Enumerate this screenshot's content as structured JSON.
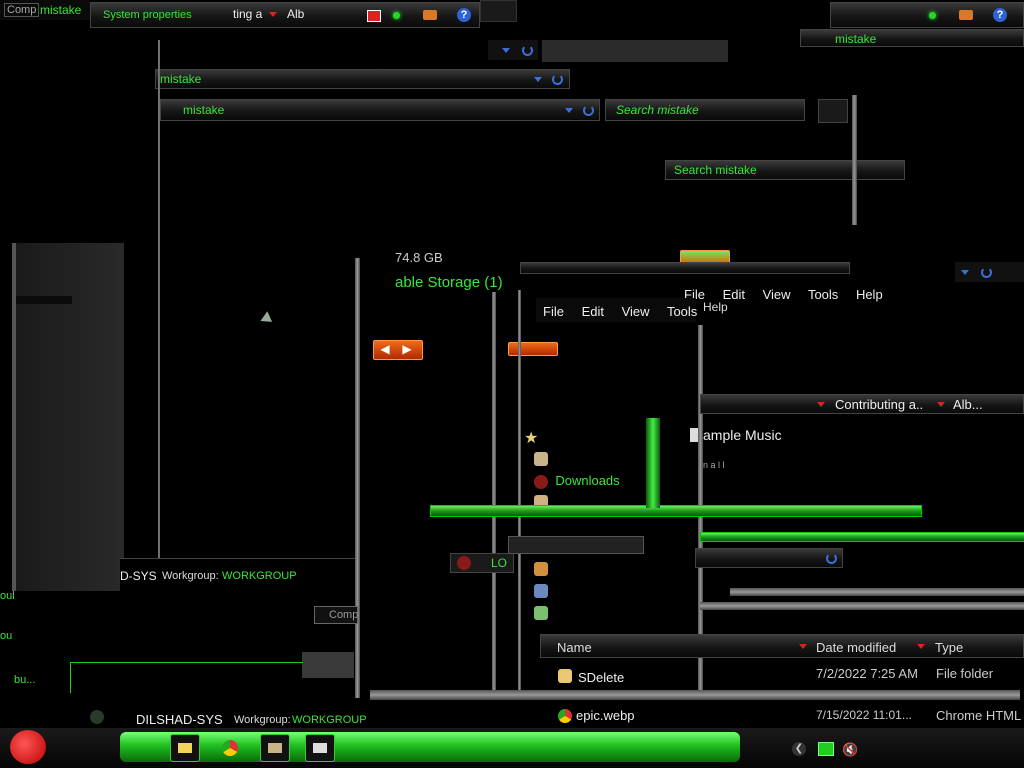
{
  "top_left": {
    "comp_label": "Comp",
    "mistake": "mistake",
    "sysprops": "System properties",
    "contrib": "ting a",
    "alb": "Alb"
  },
  "top_right": {
    "mistake": "mistake"
  },
  "addr_bars": [
    {
      "label": "mistake"
    },
    {
      "label": "mistake"
    }
  ],
  "search": {
    "label1": "Search mistake",
    "label2": "Search mistake"
  },
  "storage": {
    "size": "74.8 GB",
    "group": "able Storage (1)"
  },
  "menu_front": [
    "File",
    "Edit",
    "View",
    "Tools"
  ],
  "menu_back": [
    "File",
    "Edit",
    "View",
    "Tools",
    "Help"
  ],
  "menu_help2": "Help",
  "nav": {
    "downloads": "Downloads",
    "lo": "LO"
  },
  "music": {
    "title": "ample Music",
    "sub": "n a l l"
  },
  "columns": {
    "contributing": "Contributing a..",
    "album": "Alb..."
  },
  "workgroup_row1": {
    "pc": "D-SYS",
    "label": "Workgroup:",
    "value": "WORKGROUP"
  },
  "workgroup_row2": {
    "pc": "DILSHAD-SYS",
    "label": "Workgroup:",
    "value": "WORKGROUP"
  },
  "comp_small": "Comp",
  "file_list": {
    "headers": {
      "name": "Name",
      "date": "Date modified",
      "type": "Type"
    },
    "rows": [
      {
        "name": "SDelete",
        "date": "7/2/2022 7:25 AM",
        "type": "File folder"
      },
      {
        "name": "epic.webp",
        "date": "7/15/2022 11:01...",
        "type": "Chrome HTML"
      }
    ]
  },
  "left_stubs": {
    "s1": "oul",
    "s2": "ou",
    "s3": "bu..."
  },
  "colors": {
    "accent": "#39e639",
    "bg": "#000000",
    "chrome": "#2a2a2a",
    "nav_orange": "#e85a14"
  },
  "taskbar": {
    "icons": [
      "angry-birds-start-icon",
      "folder-icon",
      "chrome-icon",
      "photo-tool-icon",
      "fax-icon",
      "back-icon",
      "network-icon",
      "volume-muted-icon"
    ]
  }
}
